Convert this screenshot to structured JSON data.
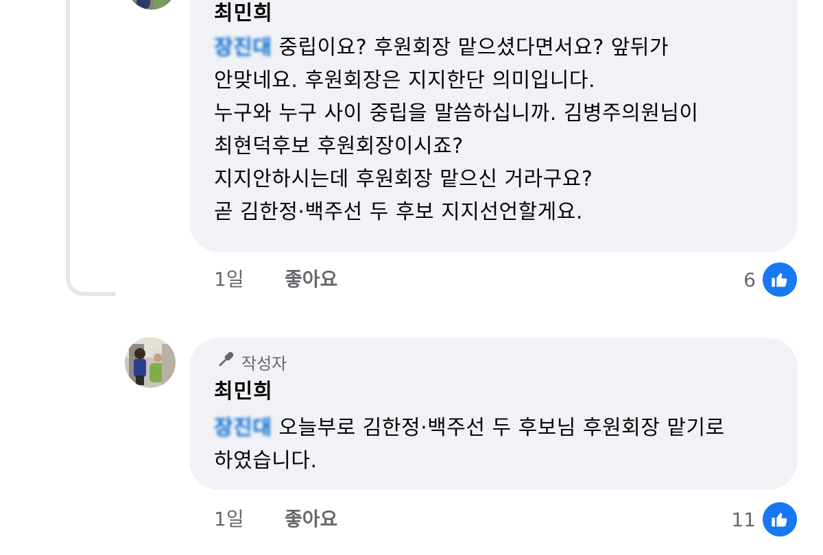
{
  "colors": {
    "bubble_bg": "#f0f2f5",
    "mention": "#0064d1",
    "meta_text": "#65676b",
    "like_blue": "#1877f2"
  },
  "comment_1": {
    "author": "최민희",
    "mention": "장진대",
    "lines": [
      " 중립이요? 후원회장 맡으셨다면서요? 앞뒤가",
      "안맞네요. 후원회장은 지지한단 의미입니다.",
      "누구와 누구 사이 중립을 말씀하십니까. 김병주의원님이",
      "최현덕후보 후원회장이시죠?",
      "지지안하시는데 후원회장 맡으신 거라구요?",
      "곧 김한정·백주선 두 후보 지지선언할게요."
    ],
    "time": "1일",
    "like_label": "좋아요",
    "like_count": "6",
    "like_icon": "thumbs-up-icon"
  },
  "comment_2": {
    "badge_icon": "microphone-icon",
    "badge_label": "작성자",
    "author": "최민희",
    "mention": "장진대",
    "lines": [
      " 오늘부로 김한정·백주선 두 후보님 후원회장 맡기로",
      "하였습니다."
    ],
    "time": "1일",
    "like_label": "좋아요",
    "like_count": "11",
    "like_icon": "thumbs-up-icon"
  }
}
